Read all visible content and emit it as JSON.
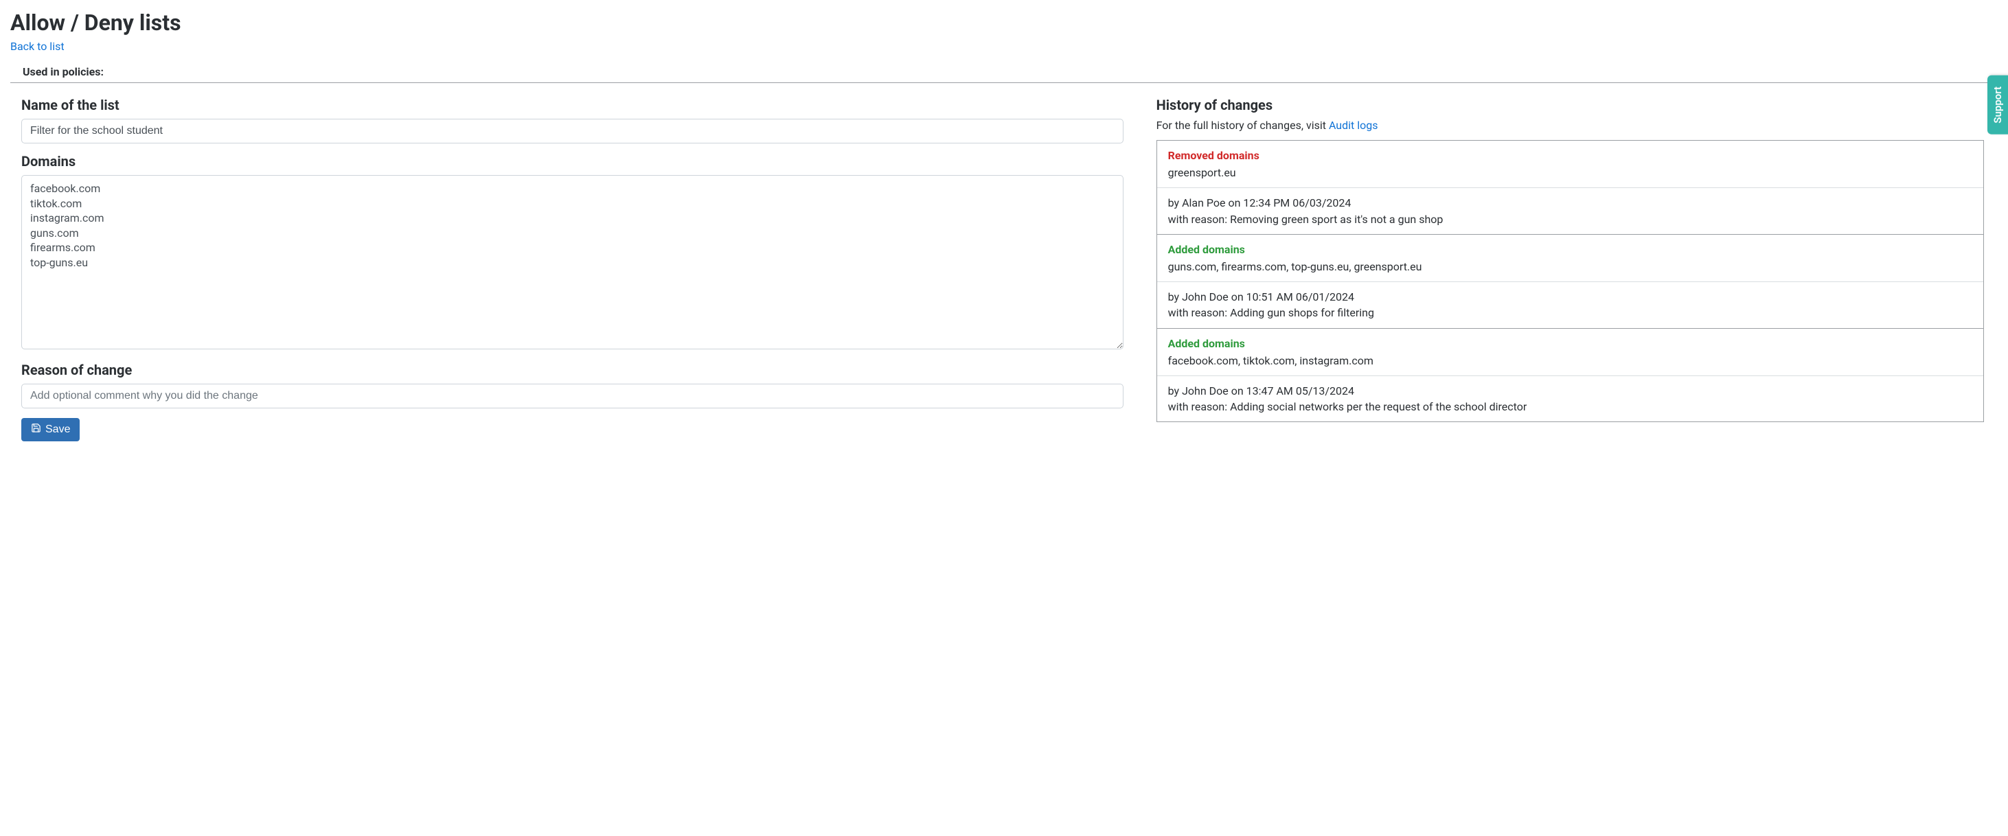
{
  "page": {
    "title": "Allow / Deny lists",
    "back_link": "Back to list",
    "policies_label": "Used in policies:"
  },
  "form": {
    "name_heading": "Name of the list",
    "name_value": "Filter for the school student",
    "domains_heading": "Domains",
    "domains_value": "facebook.com\ntiktok.com\ninstagram.com\nguns.com\nfirearms.com\ntop-guns.eu",
    "reason_heading": "Reason of change",
    "reason_placeholder": "Add optional comment why you did the change",
    "save_label": "Save"
  },
  "history": {
    "heading": "History of changes",
    "intro_prefix": "For the full history of changes, visit ",
    "audit_link": "Audit logs",
    "items": [
      {
        "kind_label": "Removed domains",
        "kind_class": "removed",
        "domains": "greensport.eu",
        "byline": "by Alan Poe on 12:34 PM 06/03/2024",
        "reason": "with reason: Removing green sport as it's not a gun shop"
      },
      {
        "kind_label": "Added domains",
        "kind_class": "added",
        "domains": "guns.com, firearms.com, top-guns.eu, greensport.eu",
        "byline": "by John Doe on 10:51 AM 06/01/2024",
        "reason": "with reason: Adding gun shops for filtering"
      },
      {
        "kind_label": "Added domains",
        "kind_class": "added",
        "domains": "facebook.com, tiktok.com, instagram.com",
        "byline": "by John Doe on 13:47 AM 05/13/2024",
        "reason": "with reason: Adding social networks per the request of the school director"
      }
    ]
  },
  "support_tab": "Support",
  "colors": {
    "primary_button": "#2f6fb3",
    "support_tab": "#34b6ab",
    "removed": "#d12a2a",
    "added": "#2e9b3c",
    "link": "#1073d6"
  }
}
